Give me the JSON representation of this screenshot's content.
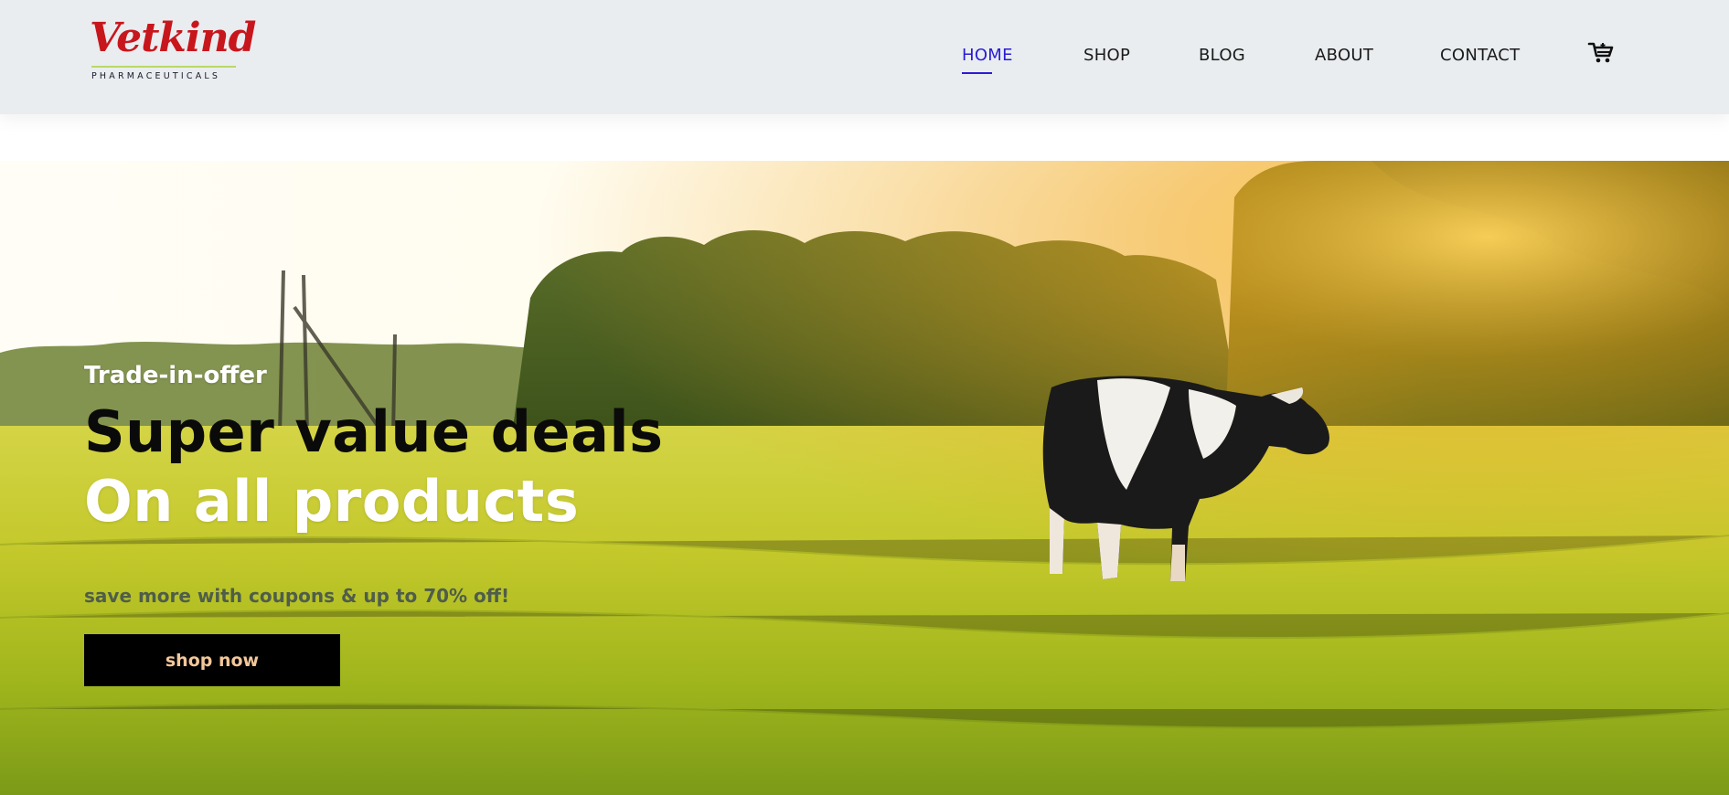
{
  "brand": {
    "logo_script": "Vetkind",
    "logo_sub": "PHARMACEUTICALS"
  },
  "nav": {
    "items": [
      {
        "label": "HOME",
        "active": true
      },
      {
        "label": "SHOP",
        "active": false
      },
      {
        "label": "BLOG",
        "active": false
      },
      {
        "label": "ABOUT",
        "active": false
      },
      {
        "label": "CONTACT",
        "active": false
      }
    ],
    "cart_icon": "shopping-cart-icon"
  },
  "hero": {
    "kicker": "Trade-in-offer",
    "headline_line1": "Super value deals",
    "headline_line2": "On all products",
    "subtext": "save more with coupons & up to 70% off!",
    "cta_label": "shop now",
    "image": "cow-grazing-meadow-sunset"
  },
  "colors": {
    "header_bg": "#e9edef",
    "nav_active": "#2a1bd6",
    "logo_red": "#c8161d",
    "cta_bg": "#000000",
    "cta_text": "#f2c79a"
  }
}
